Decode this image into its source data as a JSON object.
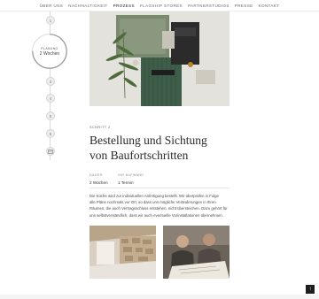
{
  "nav": {
    "items": [
      "ÜBER UNS",
      "NACHHALTIGKEIT",
      "PROZESS",
      "FLAGSHIP STORES",
      "PARTNERSTUDIOS",
      "PRESSE",
      "KONTAKT"
    ],
    "active_index": 2
  },
  "steps": {
    "before": [
      "1"
    ],
    "active": {
      "label": "PLANUNG",
      "value": "2 Wochen",
      "progress": 0.75
    },
    "after": [
      "3",
      "4",
      "5",
      "6"
    ]
  },
  "content": {
    "eyebrow": "SCHRITT 2",
    "title_line1": "Bestellung und Sichtung",
    "title_line2": "von Baufortschritten",
    "meta": [
      {
        "label": "DAUER",
        "value": "2 Wochen"
      },
      {
        "label": "IHR AUFWAND",
        "value": "1 Termin"
      }
    ],
    "paragraph": [
      "Die Küche wird zur individuellen Anfertigung bestellt. Wir überprüfen in Folge",
      "alle Pläne nochmals vor Ort, so dass uns mögliche Veränderungen in Ihren",
      "Räumen, die auch Vertragsschluss entstehen, nicht übersteichen. Dazu gehört für",
      "uns selbstverständlich, dass wir auch eventuelle Vorinstallationen übernehmen."
    ]
  },
  "colors": {
    "accent": "#2a2a2a",
    "progress_ring": "#9a9a9a",
    "muted": "#8a8a8a"
  },
  "icons": {
    "to_top": "arrow-up-icon",
    "kitchen": "kitchen-icon"
  }
}
